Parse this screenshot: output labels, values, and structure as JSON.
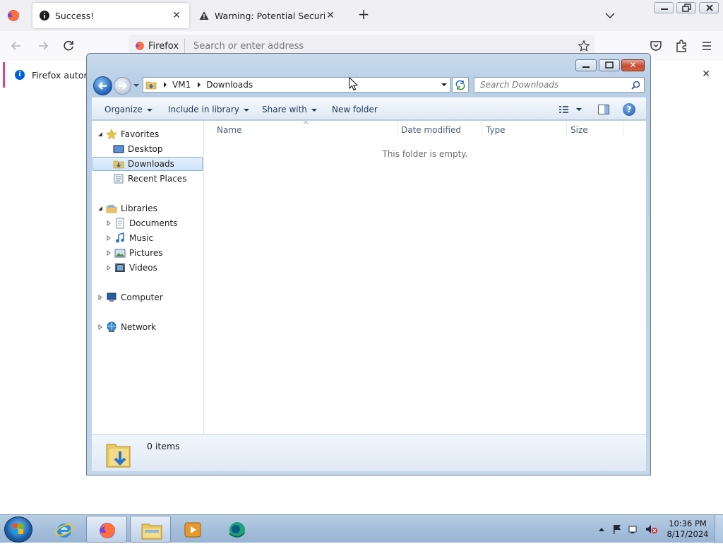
{
  "firefox": {
    "tabs": [
      {
        "title": "Success!",
        "icon": "info-icon",
        "active": true
      },
      {
        "title": "Warning: Potential Security Risk Ahead",
        "icon": "warning-icon",
        "active": false
      }
    ],
    "urlbar": {
      "badge": "Firefox",
      "placeholder": "Search or enter address"
    },
    "notification": {
      "message": "Firefox automa"
    }
  },
  "explorer": {
    "breadcrumb": [
      "VM1",
      "Downloads"
    ],
    "search_placeholder": "Search Downloads",
    "commands": {
      "organize": "Organize",
      "include_in_library": "Include in library",
      "share_with": "Share with",
      "new_folder": "New folder"
    },
    "nav": {
      "favorites": "Favorites",
      "desktop": "Desktop",
      "downloads": "Downloads",
      "recent_places": "Recent Places",
      "libraries": "Libraries",
      "documents": "Documents",
      "music": "Music",
      "pictures": "Pictures",
      "videos": "Videos",
      "computer": "Computer",
      "network": "Network"
    },
    "columns": [
      "Name",
      "Date modified",
      "Type",
      "Size"
    ],
    "empty_message": "This folder is empty.",
    "items_count": "0 items"
  },
  "taskbar": {
    "clock_time": "10:36 PM",
    "clock_date": "8/17/2024"
  },
  "colors": {
    "selection_border": "#84acdd",
    "firefox_accent": "#0060df",
    "notification_stripe": "#ed3c8a"
  }
}
